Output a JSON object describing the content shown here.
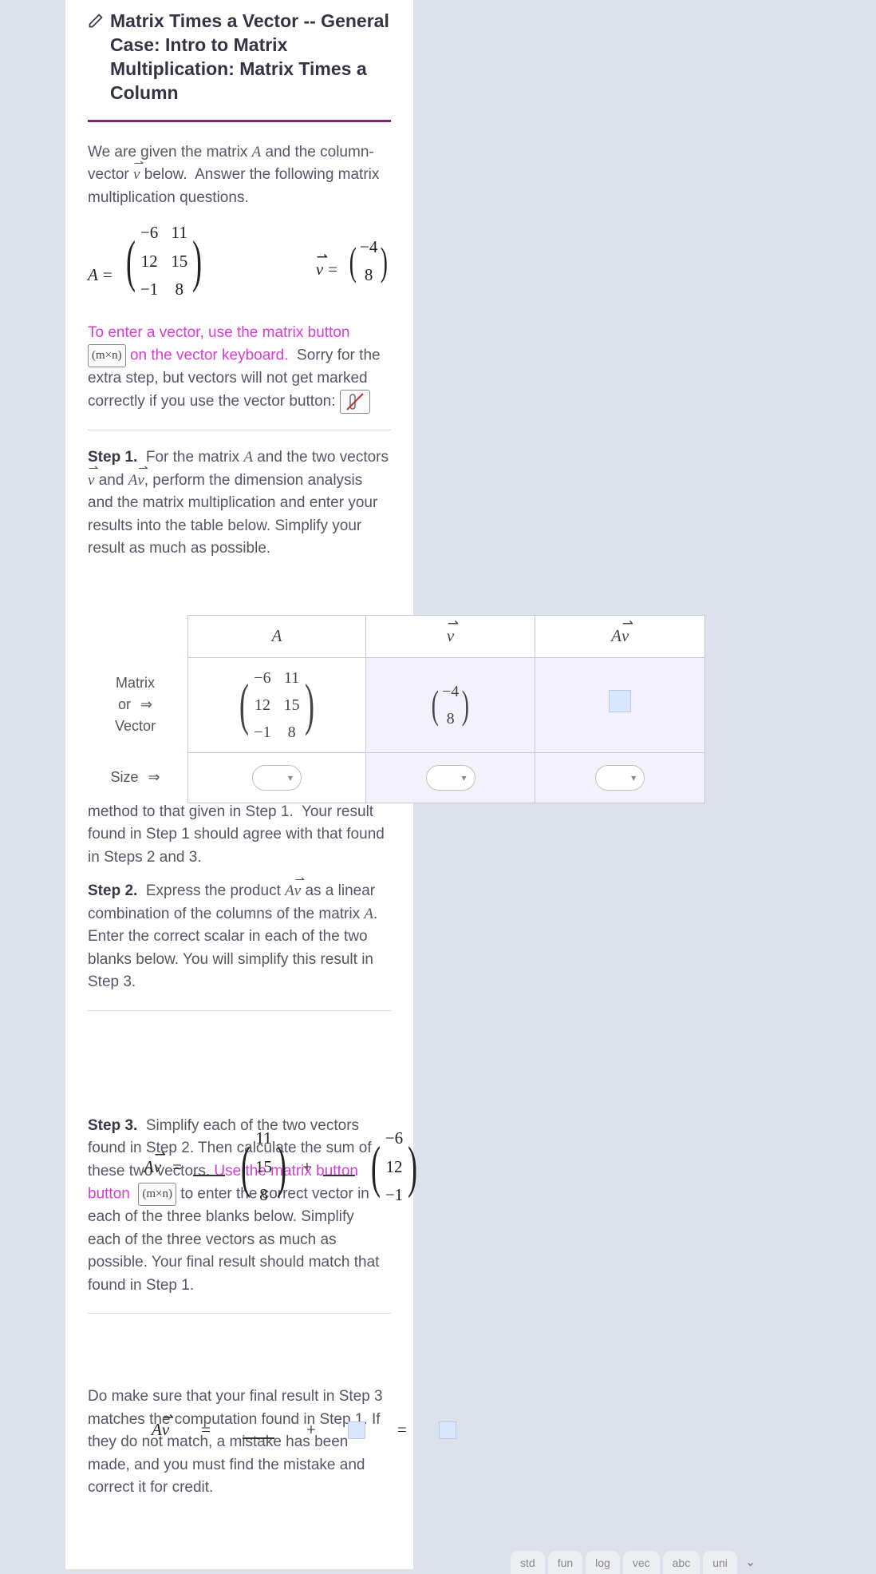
{
  "title": "Matrix Times a Vector -- General Case: Intro to Matrix Multiplication: Matrix Times a Column",
  "intro": "We are given the matrix  A  and the column-vector  v  below.  Answer the following matrix multiplication questions.",
  "given": {
    "A_label": "A",
    "A": [
      [
        "−6",
        "11"
      ],
      [
        "12",
        "15"
      ],
      [
        "−1",
        "8"
      ]
    ],
    "v_label": "v",
    "v": [
      [
        "−4"
      ],
      [
        "8"
      ]
    ]
  },
  "instruction": {
    "line1a": "To enter a vector, use the matrix button",
    "mxn": "(m×n)",
    "line1b": "on the vector keyboard.",
    "line2": "Sorry for the extra step, but vectors will not get marked correctly if you use the vector button:"
  },
  "step1": {
    "label": "Step 1.",
    "text": "For the matrix  A  and the two vectors  v  and  Av,  perform the dimension analysis and the matrix multiplication and enter your results into the table below. Simplify your result as much as possible."
  },
  "table": {
    "col_rowhead": "",
    "col_A": "A",
    "col_v": "v",
    "col_Av": "Av",
    "row1_label_a": "Matrix",
    "row1_label_b": "or",
    "row1_label_c": "Vector",
    "row2_label": "Size",
    "arrow": "⇒"
  },
  "mid_text": "In the next two steps, you will calculate the matrix product  Av  using an alternative method to that given in Step 1.  Your result found in Step 1 should agree with that found in Steps 2 and 3.",
  "step2": {
    "label": "Step 2.",
    "text": "Express the product  Av  as a linear combination of the columns of the matrix  A.  Enter the correct scalar in each of the two blanks below. You will simplify this result in Step 3.",
    "lhs": "Av",
    "eq": "=",
    "plus": "+",
    "col1": [
      "11",
      "15",
      "8"
    ],
    "col2": [
      "−6",
      "12",
      "−1"
    ]
  },
  "step3": {
    "label": "Step 3.",
    "text_a": "Simplify each of the two vectors found in Step 2. Then calculate the sum of these two vectors. ",
    "text_magenta": "Use the matrix button ",
    "mxn": "(m×n)",
    "text_b": " to enter the correct vector in each of the three blanks below. Simplify each of the three vectors as much as possible. Your final result should match that found in Step 1.",
    "lhs": "Av",
    "eq": "=",
    "plus": "+"
  },
  "closing": "Do make sure that your final result in Step 3 matches the computation found in Step 1. If they do not match, a mistake has been made, and you must find the mistake and correct it for credit.",
  "keyboard_tabs": [
    "std",
    "fun",
    "log",
    "vec",
    "abc",
    "uni"
  ]
}
